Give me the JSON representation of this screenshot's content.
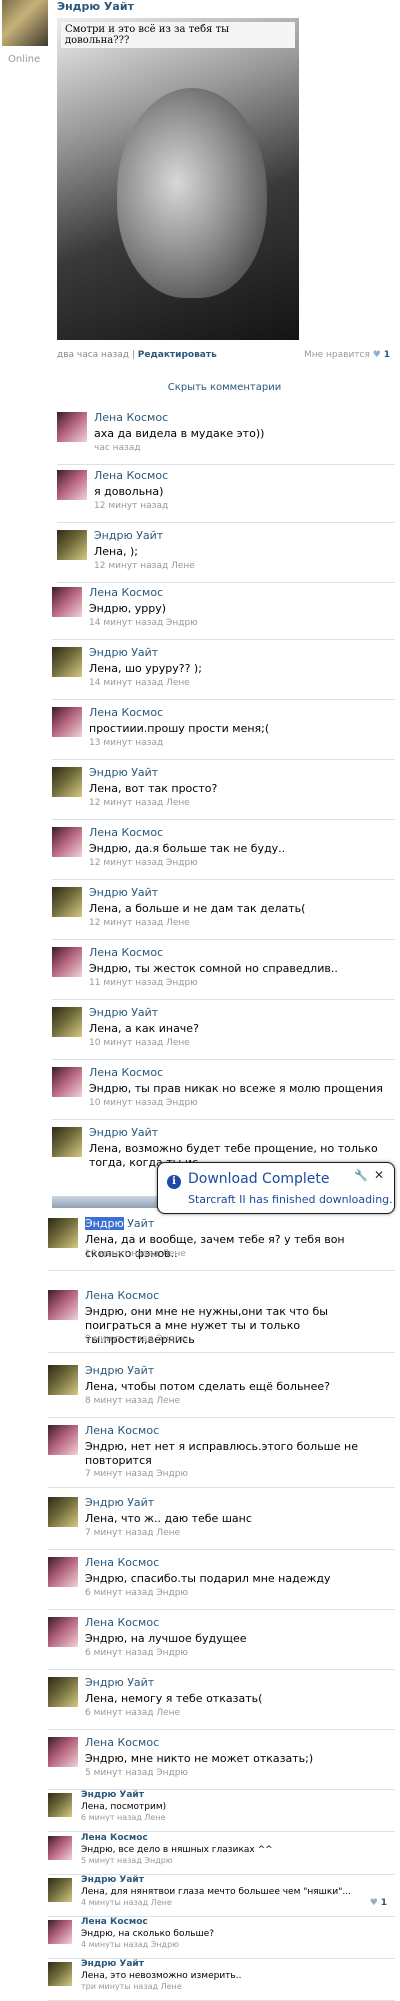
{
  "post": {
    "author": "Эндрю Уайт",
    "status": "Online",
    "photo_caption": "Смотри и это всё из за тебя ты довольна???",
    "time": "два часа назад",
    "separator": "|",
    "edit_label": "Редактировать",
    "like_label": "Мне нравится",
    "like_icon": "heart-icon",
    "like_count": "1",
    "hide_comments": "Скрыть комментарии"
  },
  "comments": [
    {
      "author": "Лена Космос",
      "text": "аха да видела в мудаке это))",
      "time": "час назад"
    },
    {
      "author": "Лена Космос",
      "text": "я довольна)",
      "time": "12 минут назад"
    },
    {
      "author": "Эндрю Уайт",
      "text": "Лена, );",
      "time": "12 минут назад Лене"
    },
    {
      "author": "Лена Космос",
      "text": "Эндрю, урру)",
      "time": "14 минут назад Эндрю"
    },
    {
      "author": "Эндрю Уайт",
      "text": "Лена, шо уруру?? );",
      "time": "14 минут назад Лене"
    },
    {
      "author": "Лена Космос",
      "text": "простиии.прошу прости меня;(",
      "time": "13 минут назад"
    },
    {
      "author": "Эндрю Уайт",
      "text": "Лена, вот так просто?",
      "time": "12 минут назад Лене"
    },
    {
      "author": "Лена Космос",
      "text": "Эндрю, да.я больше так не буду..",
      "time": "12 минут назад Эндрю"
    },
    {
      "author": "Эндрю Уайт",
      "text": "Лена, а больше и не дам так делать(",
      "time": "12 минут назад Лене"
    },
    {
      "author": "Лена Космос",
      "text": "Эндрю, ты жесток сомной но справедлив..",
      "time": "11 минут назад Эндрю"
    },
    {
      "author": "Эндрю Уайт",
      "text": "Лена, а как иначе?",
      "time": "10 минут назад Лене"
    },
    {
      "author": "Лена Космос",
      "text": "Эндрю, ты прав никак но всеже я молю прощения",
      "time": "10 минут назад Эндрю"
    },
    {
      "author": "Эндрю Уайт",
      "text": "Лена, возможно будет тебе прощение, но только тогда, когда ты ис",
      "time": ""
    },
    {
      "author": "Эндрю Уайт",
      "author_highlight": "Эндрю",
      "author_rest": " Уайт",
      "text": "Лена, да и вообще, зачем тебе я? у тебя вон сколько фэнов..",
      "time": "10 минут назад Лене"
    },
    {
      "author": "Лена Космос",
      "text": "Эндрю, они мне не нужны,они так что бы поиграться а мне нужет ты и только ты.прости,вернись",
      "time": "9 минут назад Эндрю"
    },
    {
      "author": "Эндрю Уайт",
      "text": "Лена, чтобы потом сделать ещё больнее?",
      "time": "8 минут назад Лене"
    },
    {
      "author": "Лена Космос",
      "text": "Эндрю, нет нет я исправлюсь.этого больше не повторится",
      "time": "7 минут назад Эндрю"
    },
    {
      "author": "Эндрю Уайт",
      "text": "Лена, что ж.. даю тебе шанс",
      "time": "7 минут назад Лене"
    },
    {
      "author": "Лена Космос",
      "text": "Эндрю, спасибо.ты подарил мне надежду",
      "time": "6 минут назад Эндрю"
    },
    {
      "author": "Лена Космос",
      "text": "Эндрю, на лучшое будущее",
      "time": "6 минут назад Эндрю"
    },
    {
      "author": "Эндрю Уайт",
      "text": "Лена, немогу я тебе отказать(",
      "time": "6 минут назад Лене"
    },
    {
      "author": "Лена Космос",
      "text": "Эндрю, мне никто не может отказать;)",
      "time": "5 минут назад Эндрю"
    },
    {
      "author": "Эндрю Уайт",
      "text": "Лена, посмотрим)",
      "time": "6 минут назад Лене"
    },
    {
      "author": "Лена Космос",
      "text": "Эндрю, все дело в няшных глазиках ^^",
      "time": "5 минут назад Эндрю"
    },
    {
      "author": "Эндрю Уайт",
      "text": "Лена, для нянятвои глаза мечто большее чем \"няшки\"...",
      "time": "4 минуты назад Лене",
      "like_count": "1"
    },
    {
      "author": "Лена Космос",
      "text": "Эндрю, на сколько больше?",
      "time": "4 минуты назад Эндрю"
    },
    {
      "author": "Эндрю Уайт",
      "text": "Лена, это невозможно измерить..",
      "time": "три минуты назад Лене"
    }
  ],
  "notification": {
    "icon": "info-icon",
    "title": "Download Complete",
    "message": "Starcraft II has finished downloading.",
    "tool_icon": "wrench-icon",
    "close_icon": "close-icon",
    "close_glyph": "✕",
    "tool_glyph": "🔧"
  }
}
